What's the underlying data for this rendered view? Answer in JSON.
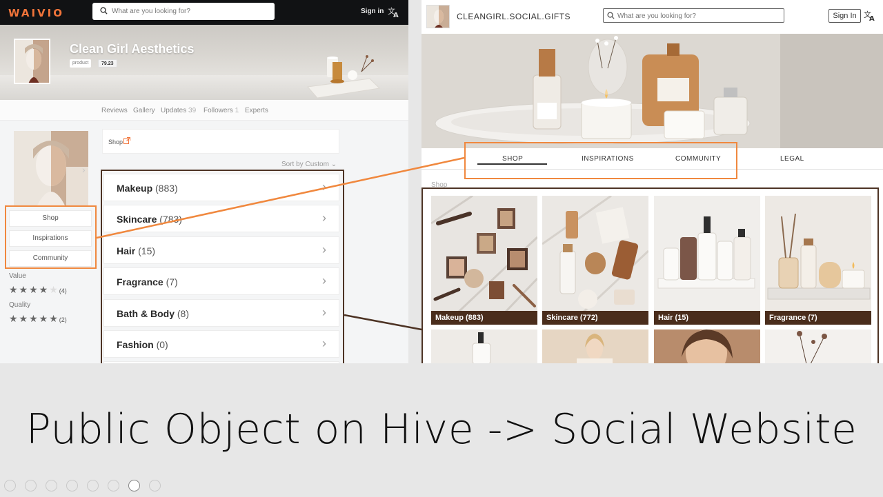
{
  "left_panel": {
    "logo": "WAIVIO",
    "search_placeholder": "What are you looking for?",
    "sign_in": "Sign in",
    "object_title": "Clean Girl Aesthetics",
    "object_type": "product",
    "object_score": "79.23",
    "tabs": [
      {
        "label": "Reviews",
        "count": ""
      },
      {
        "label": "Gallery",
        "count": ""
      },
      {
        "label": "Updates",
        "count": "39"
      },
      {
        "label": "Followers",
        "count": "1"
      },
      {
        "label": "Experts",
        "count": ""
      }
    ],
    "menu": [
      "Shop",
      "Inspirations",
      "Community"
    ],
    "ratings": [
      {
        "label": "Value",
        "stars": 4,
        "count": "(4)"
      },
      {
        "label": "Quality",
        "stars": 5,
        "count": "(2)"
      }
    ],
    "shop_link": "Shop",
    "sort_label": "Sort by",
    "sort_value": "Custom",
    "categories": [
      {
        "name": "Makeup",
        "count": "(883)"
      },
      {
        "name": "Skincare",
        "count": "(783)"
      },
      {
        "name": "Hair",
        "count": "(15)"
      },
      {
        "name": "Fragrance",
        "count": "(7)"
      },
      {
        "name": "Bath & Body",
        "count": "(8)"
      },
      {
        "name": "Fashion",
        "count": "(0)"
      }
    ]
  },
  "right_panel": {
    "site_name": "CLEANGIRL.SOCIAL.GIFTS",
    "search_placeholder": "What are you looking for?",
    "sign_in": "Sign In",
    "nav": [
      "SHOP",
      "INSPIRATIONS",
      "COMMUNITY",
      "LEGAL"
    ],
    "section_label": "Shop",
    "tiles": [
      "Makeup (883)",
      "Skincare (772)",
      "Hair (15)",
      "Fragrance (7)"
    ]
  },
  "caption": "Public Object on Hive -> Social Website",
  "colors": {
    "accent_orange": "#f0883e",
    "brown": "#4d3324",
    "logo_orange": "#f1743a",
    "caption_bar": "#4a2d1c"
  }
}
